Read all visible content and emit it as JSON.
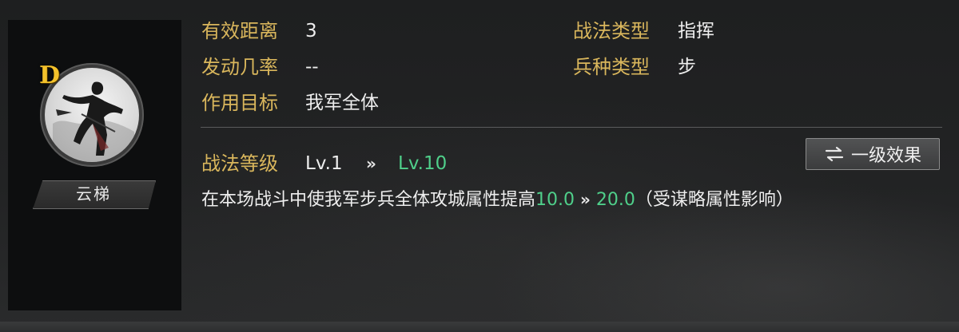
{
  "skill_card": {
    "grade": "D",
    "name": "云梯",
    "rows": {
      "range": {
        "label": "有效距离",
        "value": "3"
      },
      "trigger_rate": {
        "label": "发动几率",
        "value": "--"
      },
      "target": {
        "label": "作用目标",
        "value": "我军全体"
      },
      "skill_type": {
        "label": "战法类型",
        "value": "指挥"
      },
      "troop_type": {
        "label": "兵种类型",
        "value": "步"
      }
    },
    "level": {
      "label": "战法等级",
      "current": "Lv.1",
      "arrow": "»",
      "max": "Lv.10"
    },
    "effect_button": {
      "label": "一级效果",
      "icon": "swap-arrows-icon"
    },
    "description": {
      "text_before": "在本场战斗中使我军步兵全体攻城属性提高",
      "value_from": "10.0",
      "arrow": "»",
      "value_to": "20.0",
      "text_after": "（受谋略属性影响）"
    }
  },
  "colors": {
    "label_gold": "#d9b65c",
    "value_green": "#4fcf8a",
    "grade_yellow": "#f4c22b"
  }
}
